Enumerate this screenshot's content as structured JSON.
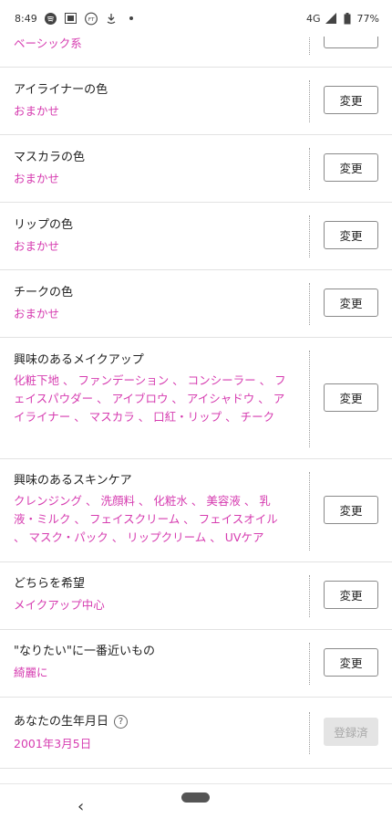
{
  "status_bar": {
    "time": "8:49",
    "network": "4G",
    "battery": "77%",
    "icons": [
      "spotify-icon",
      "media-icon",
      "ft-icon",
      "download-icon",
      "dot-icon",
      "signal-icon",
      "battery-icon"
    ]
  },
  "rows": [
    {
      "label": "",
      "value": "ベーシック系",
      "button": ""
    },
    {
      "label": "アイライナーの色",
      "value": "おまかせ",
      "button": "変更"
    },
    {
      "label": "マスカラの色",
      "value": "おまかせ",
      "button": "変更"
    },
    {
      "label": "リップの色",
      "value": "おまかせ",
      "button": "変更"
    },
    {
      "label": "チークの色",
      "value": "おまかせ",
      "button": "変更"
    },
    {
      "label": "興味のあるメイクアップ",
      "value": "化粧下地 、 ファンデーション 、 コンシーラー 、 フェイスパウダー 、 アイブロウ 、 アイシャドウ 、 アイライナー 、 マスカラ 、 口紅・リップ 、 チーク",
      "button": "変更"
    },
    {
      "label": "興味のあるスキンケア",
      "value": "クレンジング 、 洗顔料 、 化粧水 、 美容液 、 乳液・ミルク 、 フェイスクリーム 、 フェイスオイル 、 マスク・パック 、 リップクリーム 、 UVケア",
      "button": "変更"
    },
    {
      "label": "どちらを希望",
      "value": "メイクアップ中心",
      "button": "変更"
    },
    {
      "label": "\"なりたい\"に一番近いもの",
      "value": "綺麗に",
      "button": "変更"
    },
    {
      "label": "あなたの生年月日",
      "value": "2001年3月5日",
      "button": "登録済",
      "help": "?"
    }
  ],
  "nav": {
    "back": "‹"
  },
  "colors": {
    "accent": "#d63cb0",
    "divider": "#e2e2e2"
  }
}
